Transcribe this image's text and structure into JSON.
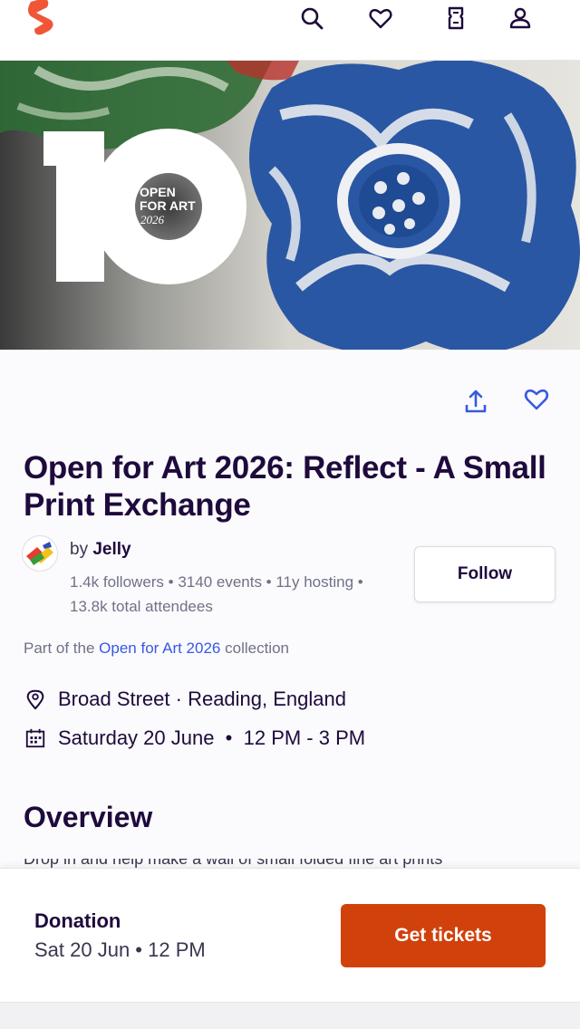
{
  "header": {
    "logo_icon": "brand-logo-icon",
    "brand_color": "#f05537",
    "icons": [
      "search-icon",
      "heart-icon",
      "tickets-icon",
      "account-icon"
    ]
  },
  "hero": {
    "big_number": "10",
    "badge_line1": "OPEN",
    "badge_line2": "FOR ART",
    "badge_line3": "2026"
  },
  "actions": {
    "share_icon": "share-icon",
    "like_icon": "heart-outline-icon",
    "accent_color": "#3659e3"
  },
  "event": {
    "title": "Open for Art 2026: Reflect - A Small Print Exchange"
  },
  "organizer": {
    "by_label": "by",
    "name": "Jelly",
    "stats": "1.4k followers • 3140 events • 11y hosting • 13.8k total attendees",
    "follow_label": "Follow"
  },
  "collection": {
    "prefix": "Part of the",
    "link": "Open for Art 2026",
    "suffix": "collection"
  },
  "details": {
    "location": "Broad Street · Reading, England",
    "datetime": "Saturday 20 June  •  12 PM - 3 PM"
  },
  "overview": {
    "heading": "Overview",
    "peek_text": "Drop in and help make a wall of small folded fine art prints"
  },
  "footer": {
    "price": "Donation",
    "when": "Sat 20 Jun • 12 PM",
    "cta_label": "Get tickets",
    "cta_color": "#d1410c"
  }
}
